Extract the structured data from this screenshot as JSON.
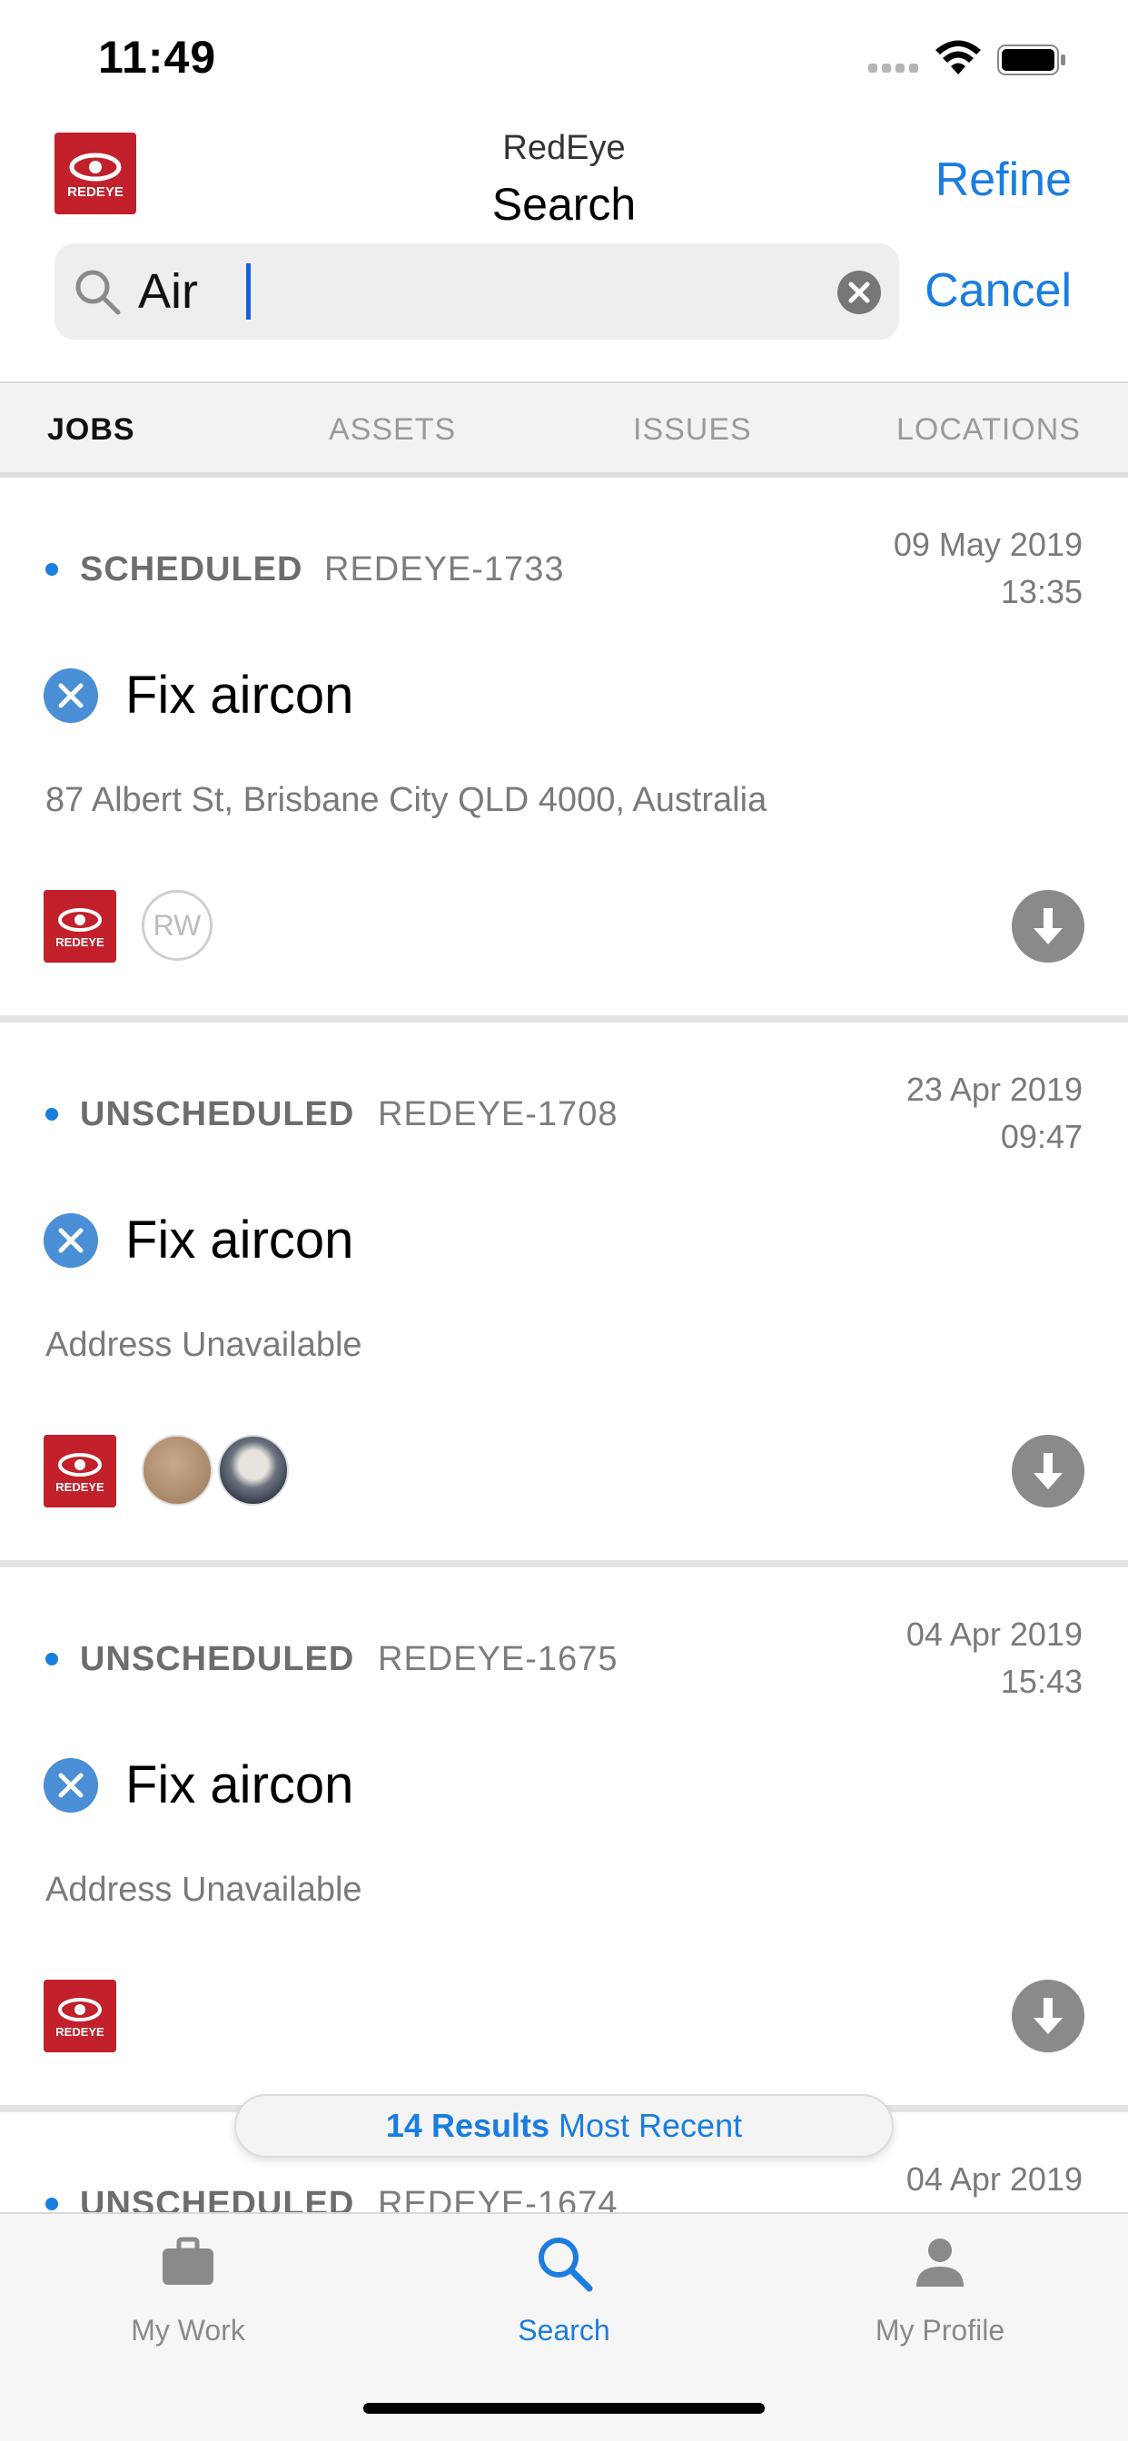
{
  "status_bar": {
    "time": "11:49"
  },
  "header": {
    "app_name": "RedEye",
    "title": "Search",
    "refine_label": "Refine",
    "logo_text": "REDEYE"
  },
  "search": {
    "value": "Air",
    "cancel_label": "Cancel"
  },
  "tabs": [
    "JOBS",
    "ASSETS",
    "ISSUES",
    "LOCATIONS"
  ],
  "active_tab": "JOBS",
  "jobs": [
    {
      "status": "SCHEDULED",
      "id": "REDEYE-1733",
      "date": "09 May 2019",
      "time": "13:35",
      "title": "Fix aircon",
      "address": "87 Albert St, Brisbane City QLD 4000, Australia",
      "assignee_initials": "RW"
    },
    {
      "status": "UNSCHEDULED",
      "id": "REDEYE-1708",
      "date": "23 Apr 2019",
      "time": "09:47",
      "title": "Fix aircon",
      "address": "Address Unavailable"
    },
    {
      "status": "UNSCHEDULED",
      "id": "REDEYE-1675",
      "date": "04 Apr 2019",
      "time": "15:43",
      "title": "Fix aircon",
      "address": "Address Unavailable"
    },
    {
      "status": "UNSCHEDULED",
      "id": "REDEYE-1674",
      "date": "04 Apr 2019"
    }
  ],
  "results": {
    "count_label": "14 Results",
    "sort_label": "Most Recent"
  },
  "tab_bar": [
    {
      "label": "My Work",
      "icon": "briefcase-icon"
    },
    {
      "label": "Search",
      "icon": "search-icon"
    },
    {
      "label": "My Profile",
      "icon": "person-icon"
    }
  ],
  "colors": {
    "accent": "#1a7de0",
    "brand_red": "#c2202a",
    "status_dot": "#1a7de0"
  }
}
